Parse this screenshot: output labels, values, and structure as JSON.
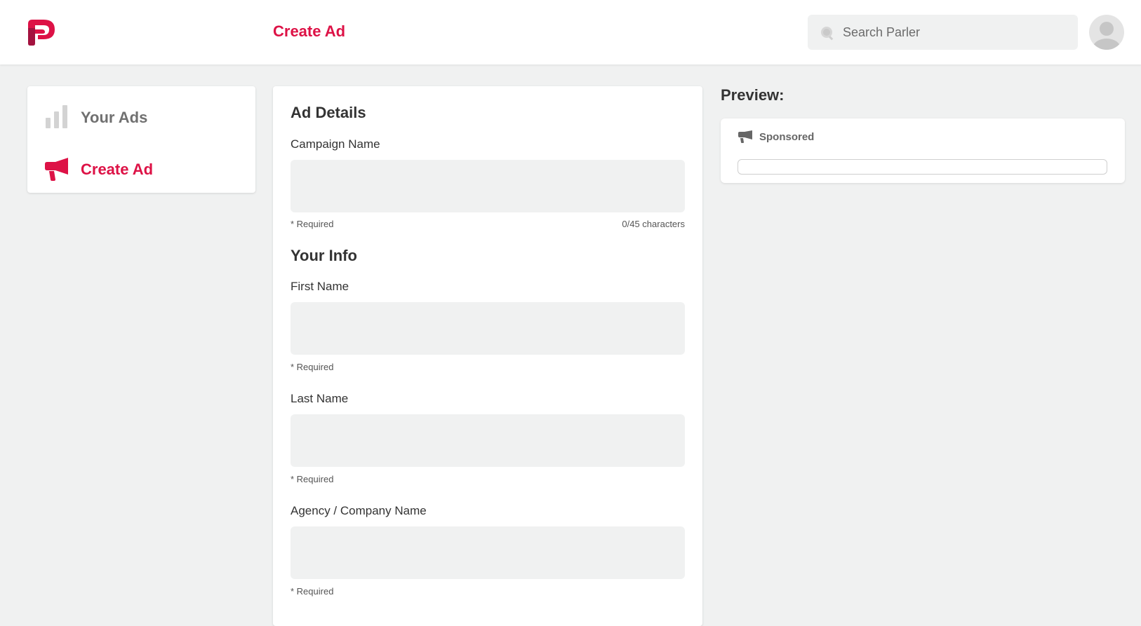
{
  "header": {
    "title": "Create Ad",
    "search_placeholder": "Search Parler"
  },
  "sidebar": {
    "items": [
      {
        "label": "Your Ads",
        "icon": "bar-chart-icon",
        "active": false
      },
      {
        "label": "Create Ad",
        "icon": "megaphone-icon",
        "active": true
      }
    ]
  },
  "form": {
    "ad_details": {
      "title": "Ad Details",
      "campaign_name": {
        "label": "Campaign Name",
        "value": "",
        "hint": "* Required",
        "counter": "0/45 characters"
      }
    },
    "your_info": {
      "title": "Your Info",
      "first_name": {
        "label": "First Name",
        "value": "",
        "hint": "* Required"
      },
      "last_name": {
        "label": "Last Name",
        "value": "",
        "hint": "* Required"
      },
      "company": {
        "label": "Agency / Company Name",
        "value": "",
        "hint": "* Required"
      }
    }
  },
  "preview": {
    "title": "Preview:",
    "sponsored_label": "Sponsored"
  },
  "colors": {
    "brand": "#dd1246",
    "background": "#f0f1f1",
    "muted": "#707070"
  }
}
